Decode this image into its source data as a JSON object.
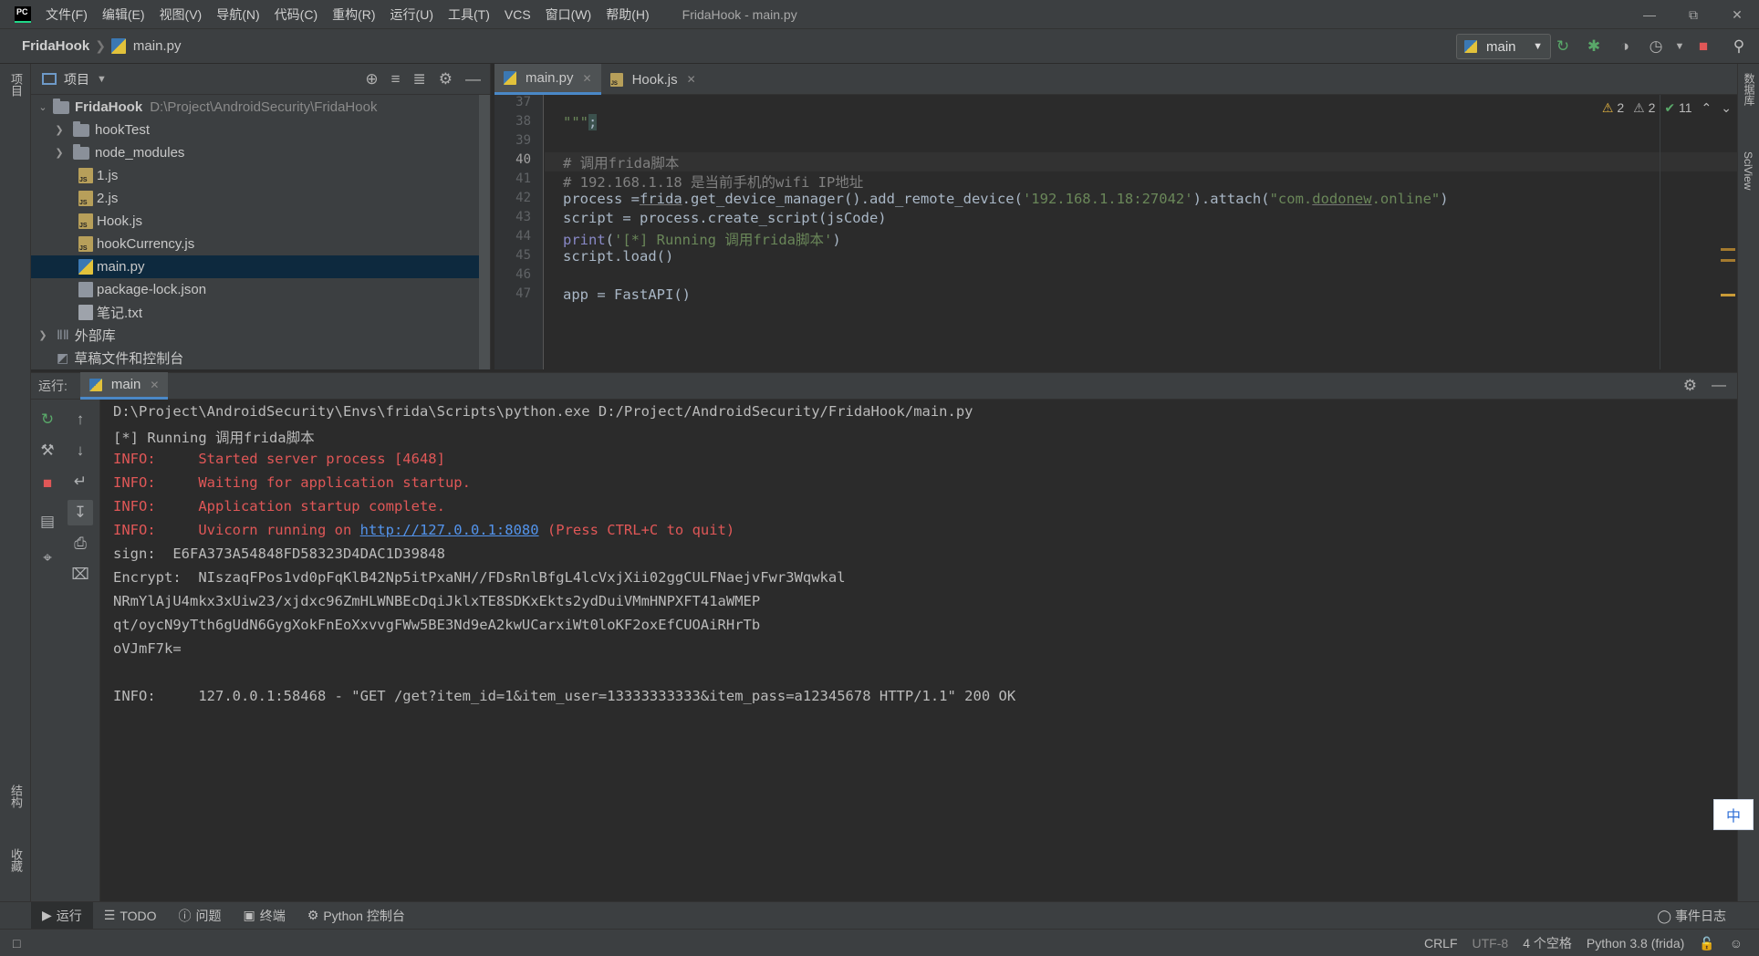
{
  "menubar": {
    "items": [
      "文件(F)",
      "编辑(E)",
      "视图(V)",
      "导航(N)",
      "代码(C)",
      "重构(R)",
      "运行(U)",
      "工具(T)",
      "VCS",
      "窗口(W)",
      "帮助(H)"
    ],
    "window_title": "FridaHook - main.py",
    "logo_text": "PC"
  },
  "navbar": {
    "project": "FridaHook",
    "file": "main.py",
    "run_config": "main"
  },
  "project_panel": {
    "title": "项目",
    "root": {
      "name": "FridaHook",
      "path": "D:\\Project\\AndroidSecurity\\FridaHook"
    },
    "items": [
      {
        "name": "hookTest",
        "type": "folder"
      },
      {
        "name": "node_modules",
        "type": "folder"
      },
      {
        "name": "1.js",
        "type": "js"
      },
      {
        "name": "2.js",
        "type": "js"
      },
      {
        "name": "Hook.js",
        "type": "js"
      },
      {
        "name": "hookCurrency.js",
        "type": "js"
      },
      {
        "name": "main.py",
        "type": "py"
      },
      {
        "name": "package-lock.json",
        "type": "json"
      },
      {
        "name": "笔记.txt",
        "type": "txt"
      }
    ],
    "external_libs": "外部库",
    "scratches": "草稿文件和控制台"
  },
  "editor": {
    "tabs": [
      {
        "label": "main.py",
        "active": true
      },
      {
        "label": "Hook.js",
        "active": false
      }
    ],
    "line_numbers": [
      "37",
      "38",
      "39",
      "40",
      "41",
      "42",
      "43",
      "44",
      "45",
      "46",
      "47"
    ],
    "current_line": "40",
    "inspections": {
      "warnings_a": "2",
      "warnings_b": "2",
      "ok": "11"
    }
  },
  "run_panel": {
    "label": "运行:",
    "tab": "main",
    "console": {
      "cmd": "D:\\Project\\AndroidSecurity\\Envs\\frida\\Scripts\\python.exe D:/Project/AndroidSecurity/FridaHook/main.py",
      "running": "[*] Running 调用frida脚本",
      "info1": "INFO:     Started server process [4648]",
      "info2": "INFO:     Waiting for application startup.",
      "info3": "INFO:     Application startup complete.",
      "info4_prefix": "INFO:     Uvicorn running on ",
      "info4_link": "http://127.0.0.1:8080",
      "info4_suffix": " (Press CTRL+C to quit)",
      "sign": "sign:  E6FA373A54848FD58323D4DAC1D39848",
      "encrypt1": "Encrypt:  NIszaqFPos1vd0pFqKlB42Np5itPxaNH//FDsRnlBfgL4lcVxjXii02ggCULFNaejvFwr3Wqwkal",
      "encrypt2": "NRmYlAjU4mkx3xUiw23/xjdxc96ZmHLWNBEcDqiJklxTE8SDKxEkts2ydDuiVMmHNPXFT41aWMEP",
      "encrypt3": "qt/oycN9yTth6gUdN6GygXokFnEoXxvvgFWw5BE3Nd9eA2kwUCarxiWt0loKF2oxEfCUOAiRHrTb",
      "encrypt4": "oVJmF7k=",
      "info5": "INFO:     127.0.0.1:58468 - \"GET /get?item_id=1&item_user=13333333333&item_pass=a12345678 HTTP/1.1\" 200 OK"
    }
  },
  "bottom_tools": {
    "run": "运行",
    "todo": "TODO",
    "problems": "问题",
    "terminal": "终端",
    "python_console": "Python 控制台",
    "event_log": "事件日志"
  },
  "statusbar": {
    "line_sep": "CRLF",
    "encoding": "UTF-8",
    "indent": "4 个空格",
    "interpreter": "Python 3.8 (frida)"
  },
  "side_tabs": {
    "project": "项目",
    "structure": "结构",
    "favorites": "收藏",
    "database": "数据库",
    "sciview": "SciView"
  },
  "ime": "中",
  "colors": {
    "accent": "#4a88c7",
    "error_text": "#e05757",
    "link": "#5394ec",
    "selection": "#0d293e"
  }
}
